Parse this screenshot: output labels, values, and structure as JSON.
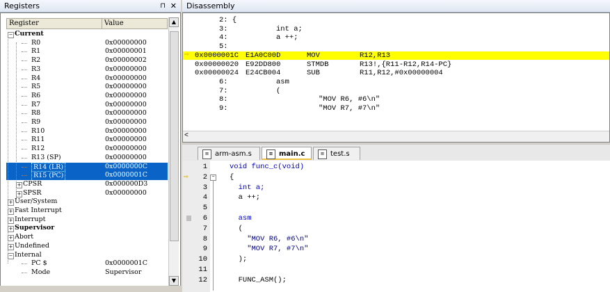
{
  "registers": {
    "title": "Registers",
    "pin": "⊓",
    "close": "✕",
    "columns": [
      "Register",
      "Value"
    ],
    "rows": [
      {
        "name": "Current",
        "value": "",
        "bold": true,
        "exp": "−",
        "indent": 0
      },
      {
        "name": "R0",
        "value": "0x00000000",
        "indent": 2
      },
      {
        "name": "R1",
        "value": "0x00000001",
        "indent": 2
      },
      {
        "name": "R2",
        "value": "0x00000002",
        "indent": 2
      },
      {
        "name": "R3",
        "value": "0x00000000",
        "indent": 2
      },
      {
        "name": "R4",
        "value": "0x00000000",
        "indent": 2
      },
      {
        "name": "R5",
        "value": "0x00000000",
        "indent": 2
      },
      {
        "name": "R6",
        "value": "0x00000000",
        "indent": 2
      },
      {
        "name": "R7",
        "value": "0x00000000",
        "indent": 2
      },
      {
        "name": "R8",
        "value": "0x00000000",
        "indent": 2
      },
      {
        "name": "R9",
        "value": "0x00000000",
        "indent": 2
      },
      {
        "name": "R10",
        "value": "0x00000000",
        "indent": 2
      },
      {
        "name": "R11",
        "value": "0x00000000",
        "indent": 2
      },
      {
        "name": "R12",
        "value": "0x00000000",
        "indent": 2
      },
      {
        "name": "R13 (SP)",
        "value": "0x00000000",
        "indent": 2
      },
      {
        "name": "R14 (LR)",
        "value": "0x0000000C",
        "indent": 2,
        "selected": true
      },
      {
        "name": "R15 (PC)",
        "value": "0x0000001C",
        "indent": 2,
        "selected": true
      },
      {
        "name": "CPSR",
        "value": "0x000000D3",
        "exp": "+",
        "indent": 1
      },
      {
        "name": "SPSR",
        "value": "0x00000000",
        "exp": "+",
        "indent": 1
      },
      {
        "name": "User/System",
        "value": "",
        "exp": "+",
        "indent": 0
      },
      {
        "name": "Fast Interrupt",
        "value": "",
        "exp": "+",
        "indent": 0
      },
      {
        "name": "Interrupt",
        "value": "",
        "exp": "+",
        "indent": 0
      },
      {
        "name": "Supervisor",
        "value": "",
        "exp": "+",
        "indent": 0,
        "bold": true
      },
      {
        "name": "Abort",
        "value": "",
        "exp": "+",
        "indent": 0
      },
      {
        "name": "Undefined",
        "value": "",
        "exp": "+",
        "indent": 0
      },
      {
        "name": "Internal",
        "value": "",
        "exp": "−",
        "indent": 0
      },
      {
        "name": "PC  $",
        "value": "0x0000001C",
        "indent": 2
      },
      {
        "name": "Mode",
        "value": "Supervisor",
        "indent": 2
      }
    ]
  },
  "disassembly": {
    "title": "Disassembly",
    "lines": [
      {
        "a": "",
        "b": "",
        "c": "2: {",
        "d": "",
        "hl": false
      },
      {
        "a": "",
        "b": "",
        "c": "3:",
        "d": "int a;",
        "hl": false
      },
      {
        "a": "",
        "b": "",
        "c": "4:",
        "d": "a ++;",
        "hl": false
      },
      {
        "a": "",
        "b": "",
        "c": "5:",
        "d": "",
        "hl": false
      },
      {
        "a": "0x0000001C",
        "b": "E1A0C00D",
        "c": "MOV",
        "d": "R12,R13",
        "hl": true
      },
      {
        "a": "0x00000020",
        "b": "E92DD800",
        "c": "STMDB",
        "d": "R13!,{R11-R12,R14-PC}",
        "hl": false
      },
      {
        "a": "0x00000024",
        "b": "E24CB004",
        "c": "SUB",
        "d": "R11,R12,#0x00000004",
        "hl": false
      },
      {
        "a": "",
        "b": "",
        "c": "6:",
        "d": "asm",
        "hl": false
      },
      {
        "a": "",
        "b": "",
        "c": "7:",
        "d": "(",
        "hl": false
      },
      {
        "a": "",
        "b": "",
        "c": "8:",
        "d": "\"MOV R6, #6\\n\"",
        "hl": false
      },
      {
        "a": "",
        "b": "",
        "c": "9:",
        "d": "\"MOV R7, #7\\n\"",
        "hl": false
      }
    ],
    "scroll_left": "<"
  },
  "editor": {
    "tabs": [
      {
        "label": "arm-asm.s",
        "active": false
      },
      {
        "label": "main.c",
        "active": true
      },
      {
        "label": "test.s",
        "active": false
      }
    ],
    "lines": [
      {
        "n": "1",
        "code": "void func_c(void)"
      },
      {
        "n": "2",
        "code": "{"
      },
      {
        "n": "3",
        "code": "  int a;"
      },
      {
        "n": "4",
        "code": "  a ++;"
      },
      {
        "n": "5",
        "code": ""
      },
      {
        "n": "6",
        "code": "  asm"
      },
      {
        "n": "7",
        "code": "  ("
      },
      {
        "n": "8",
        "code": "    \"MOV R6, #6\\n\""
      },
      {
        "n": "9",
        "code": "    \"MOV R7, #7\\n\""
      },
      {
        "n": "10",
        "code": "  );"
      },
      {
        "n": "11",
        "code": ""
      },
      {
        "n": "12",
        "code": "  FUNC_ASM();"
      }
    ]
  },
  "colors": {
    "selection": "#0a64c8",
    "highlight": "#ffff00",
    "pc_arrow": "#e0b000"
  }
}
